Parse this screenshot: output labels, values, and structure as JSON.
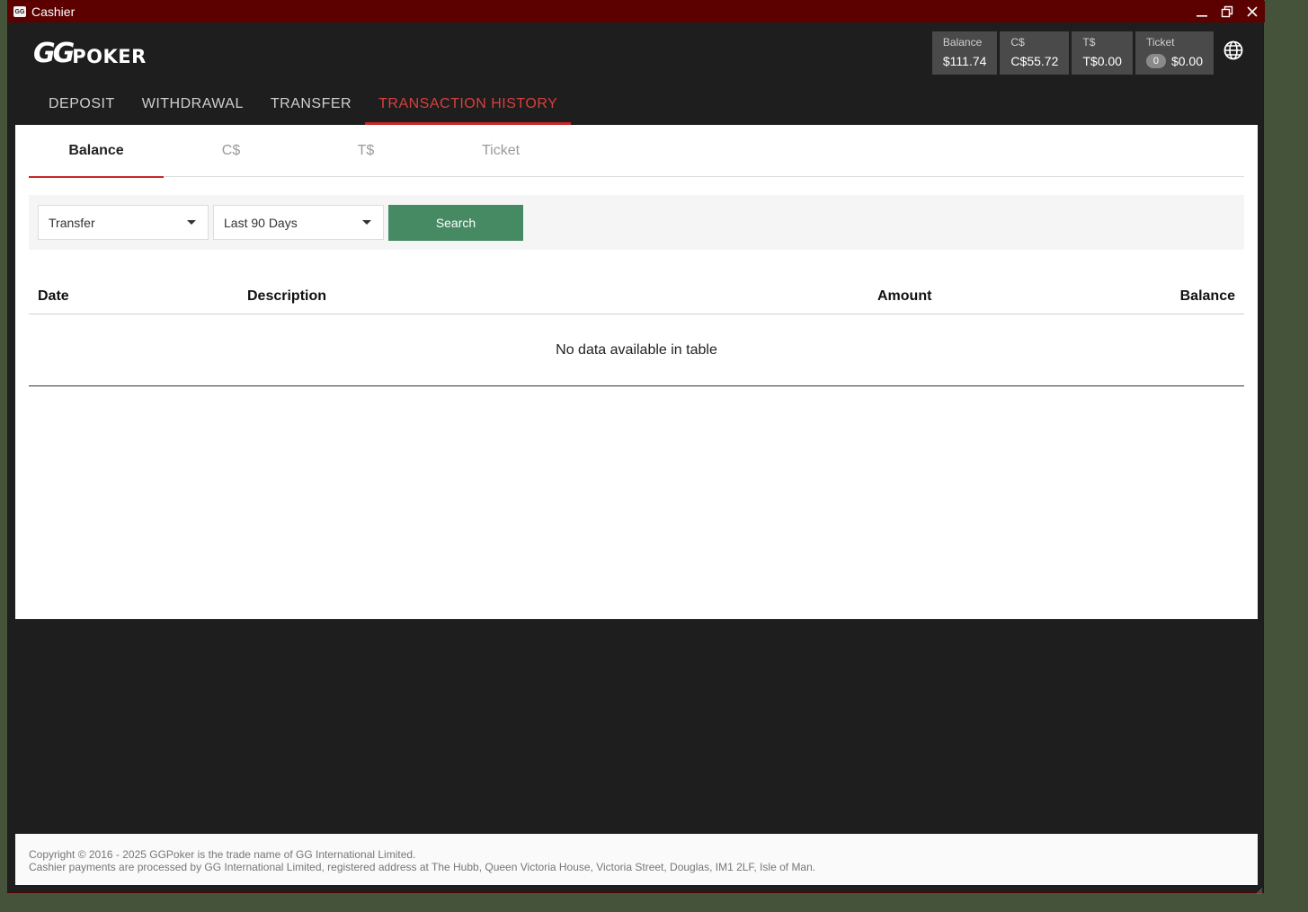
{
  "window": {
    "title": "Cashier",
    "app_icon_text": "GG"
  },
  "logo": {
    "gg": "GG",
    "poker": "POKER"
  },
  "wallets": [
    {
      "label": "Balance",
      "value": "$111.74"
    },
    {
      "label": "C$",
      "value": "C$55.72"
    },
    {
      "label": "T$",
      "value": "T$0.00"
    },
    {
      "label": "Ticket",
      "count": "0",
      "value": "$0.00"
    }
  ],
  "nav": {
    "items": [
      {
        "label": "DEPOSIT"
      },
      {
        "label": "WITHDRAWAL"
      },
      {
        "label": "TRANSFER"
      },
      {
        "label": "TRANSACTION HISTORY",
        "active": true
      }
    ]
  },
  "subtabs": {
    "items": [
      {
        "label": "Balance",
        "active": true
      },
      {
        "label": "C$"
      },
      {
        "label": "T$"
      },
      {
        "label": "Ticket"
      }
    ]
  },
  "filters": {
    "type_select": "Transfer",
    "period_select": "Last 90 Days",
    "search_label": "Search"
  },
  "table": {
    "headers": {
      "date": "Date",
      "description": "Description",
      "amount": "Amount",
      "balance": "Balance"
    },
    "empty_text": "No data available in table",
    "rows": []
  },
  "footer": {
    "line1": "Copyright © 2016 - 2025 GGPoker is the trade name of GG International Limited.",
    "line2": "Cashier payments are processed by GG International Limited, registered address at The Hubb, Queen Victoria House, Victoria Street, Douglas, IM1 2LF, Isle of Man."
  },
  "colors": {
    "titlebar": "#5c0000",
    "accent_red": "#c62828",
    "search_green": "#468a64",
    "dark_bg": "#1e1e1e"
  }
}
